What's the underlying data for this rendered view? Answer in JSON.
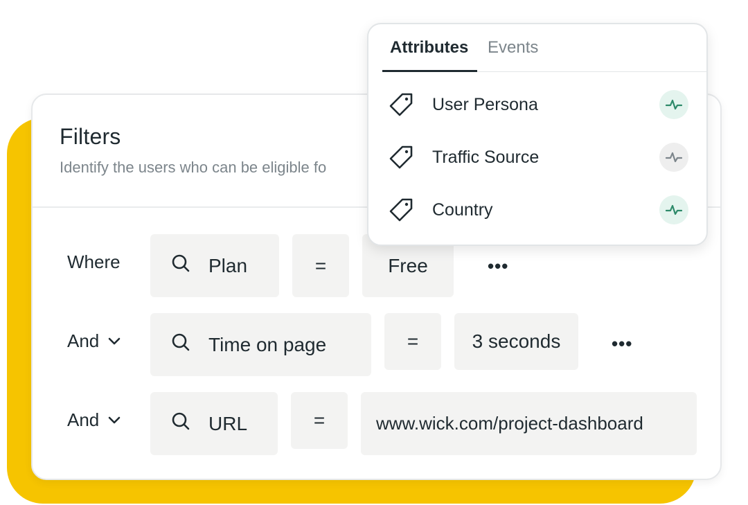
{
  "colors": {
    "accent_yellow": "#f6c400",
    "pulse_active_bg": "#e4f4ee",
    "pulse_active_fg": "#2e8a6a",
    "pulse_inactive_bg": "#eeeeee",
    "pulse_inactive_fg": "#7c858b"
  },
  "filters": {
    "title": "Filters",
    "subtitle": "Identify the users who can be eligible fo",
    "rows": [
      {
        "connector": "Where",
        "field": "Plan",
        "operator": "=",
        "value": "Free",
        "more": "•••"
      },
      {
        "connector": "And",
        "field": "Time on page",
        "operator": "=",
        "value": "3 seconds",
        "more": "•••"
      },
      {
        "connector": "And",
        "field": "URL",
        "operator": "=",
        "value": "www.wick.com/project-dashboard"
      }
    ]
  },
  "popover": {
    "tabs": [
      {
        "label": "Attributes",
        "active": true
      },
      {
        "label": "Events",
        "active": false
      }
    ],
    "items": [
      {
        "label": "User Persona",
        "icon": "tag-icon",
        "status_icon": "pulse-icon",
        "status": "active"
      },
      {
        "label": "Traffic Source",
        "icon": "tag-icon",
        "status_icon": "pulse-icon",
        "status": "inactive"
      },
      {
        "label": "Country",
        "icon": "tag-icon",
        "status_icon": "pulse-icon",
        "status": "active"
      }
    ]
  }
}
